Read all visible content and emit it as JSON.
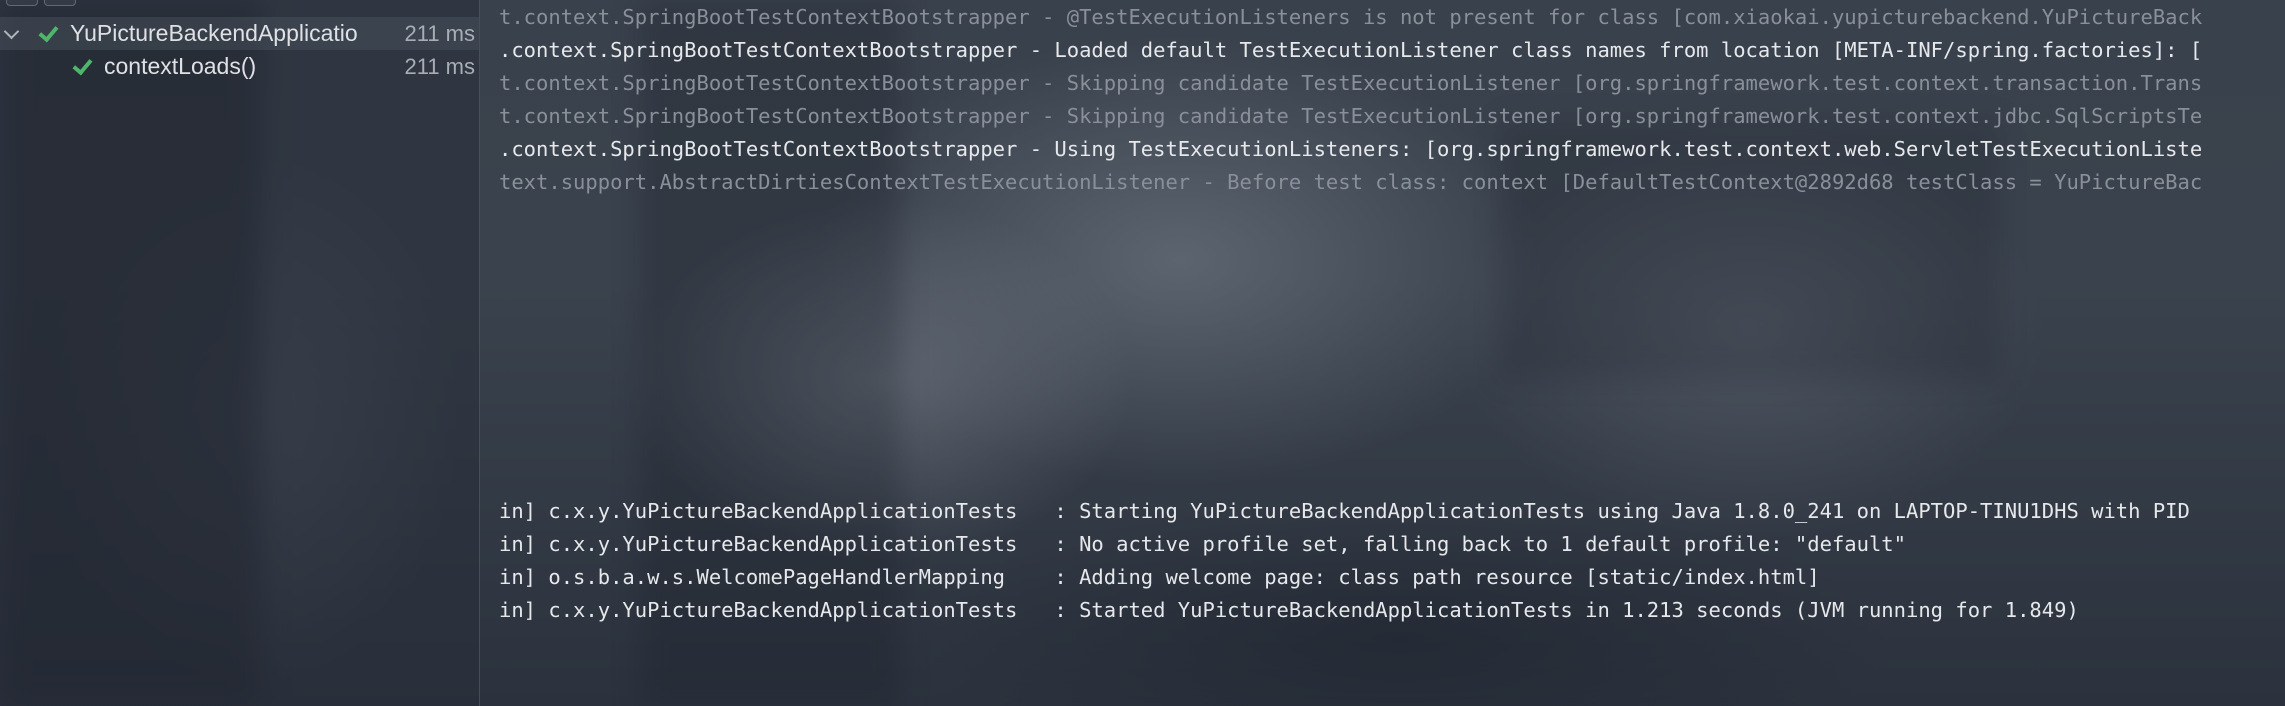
{
  "test_tree": {
    "items": [
      {
        "label": "YuPictureBackendApplicatio",
        "time": "211 ms",
        "status_icon": "check-icon",
        "expanded": true
      },
      {
        "label": "contextLoads()",
        "time": "211 ms",
        "status_icon": "check-icon"
      }
    ]
  },
  "console": {
    "top_lines": [
      {
        "text": "t.context.SpringBootTestContextBootstrapper - @TestExecutionListeners is not present for class [com.xiaokai.yupicturebackend.YuPictureBack",
        "style": "dim"
      },
      {
        "text": ".context.SpringBootTestContextBootstrapper - Loaded default TestExecutionListener class names from location [META-INF/spring.factories]: [",
        "style": "bright"
      },
      {
        "text": "t.context.SpringBootTestContextBootstrapper - Skipping candidate TestExecutionListener [org.springframework.test.context.transaction.Trans",
        "style": "dim"
      },
      {
        "text": "t.context.SpringBootTestContextBootstrapper - Skipping candidate TestExecutionListener [org.springframework.test.context.jdbc.SqlScriptsTe",
        "style": "dim"
      },
      {
        "text": ".context.SpringBootTestContextBootstrapper - Using TestExecutionListeners: [org.springframework.test.context.web.ServletTestExecutionListe",
        "style": "bright"
      },
      {
        "text": "text.support.AbstractDirtiesContextTestExecutionListener - Before test class: context [DefaultTestContext@2892d68 testClass = YuPictureBac",
        "style": "dim"
      }
    ],
    "bottom_lines": [
      {
        "text": "in] c.x.y.YuPictureBackendApplicationTests   : Starting YuPictureBackendApplicationTests using Java 1.8.0_241 on LAPTOP-TINU1DHS with PID",
        "style": "bright"
      },
      {
        "text": "in] c.x.y.YuPictureBackendApplicationTests   : No active profile set, falling back to 1 default profile: \"default\"",
        "style": "bright"
      },
      {
        "text": "in] o.s.b.a.w.s.WelcomePageHandlerMapping    : Adding welcome page: class path resource [static/index.html]",
        "style": "bright"
      },
      {
        "text": "in] c.x.y.YuPictureBackendApplicationTests   : Started YuPictureBackendApplicationTests in 1.213 seconds (JVM running for 1.849)",
        "style": "bright"
      }
    ]
  },
  "colors": {
    "pass_green": "#4eb66a",
    "console_dim": "#8a9099",
    "console_bright": "#e6e8eb"
  }
}
